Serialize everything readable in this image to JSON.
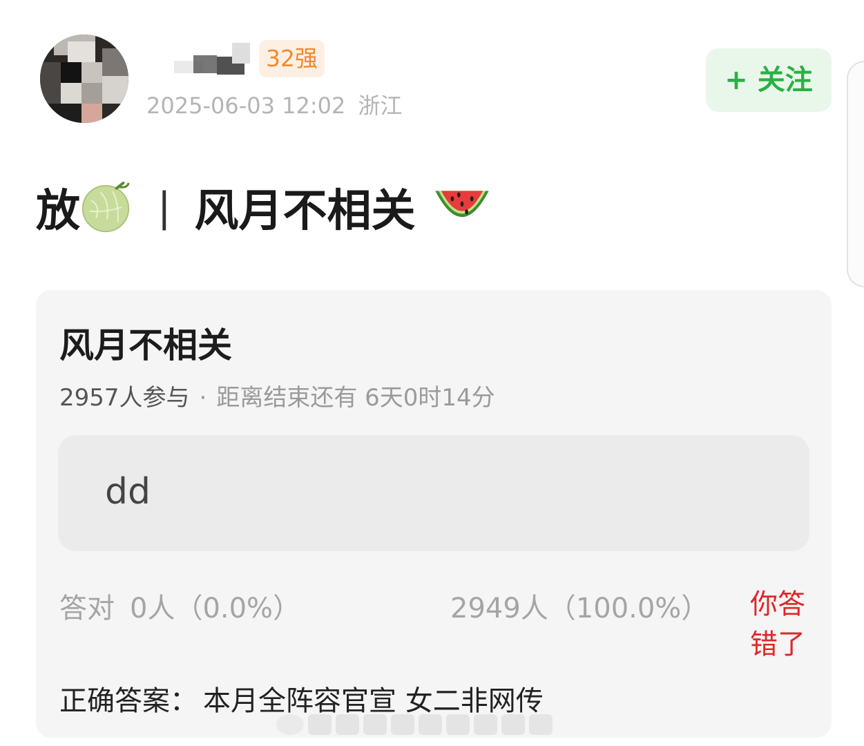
{
  "post": {
    "rank_badge": "32强",
    "timestamp": "2025-06-03 12:02",
    "location": "浙江",
    "follow_label": "+ 关注",
    "title_prefix": "放",
    "title_separator": "|",
    "title_text": "风月不相关"
  },
  "quiz": {
    "title": "风月不相关",
    "participants": "2957人参与",
    "dot": "·",
    "countdown": "距离结束还有 6天0时14分",
    "option_text": "dd",
    "correct_label": "答对",
    "correct_stat": "0人（0.0%）",
    "wrong_stat": "2949人（100.0%）",
    "result_label": "你答错了",
    "answer_label": "正确答案：",
    "answer_value": "本月全阵容官宣 女二非网传"
  },
  "colors": {
    "follow_green": "#2bb045",
    "badge_orange": "#f08a2c",
    "wrong_red": "#e0262a"
  },
  "icons": {
    "melon": "melon-emoji-icon",
    "watermelon": "watermelon-emoji-icon"
  }
}
